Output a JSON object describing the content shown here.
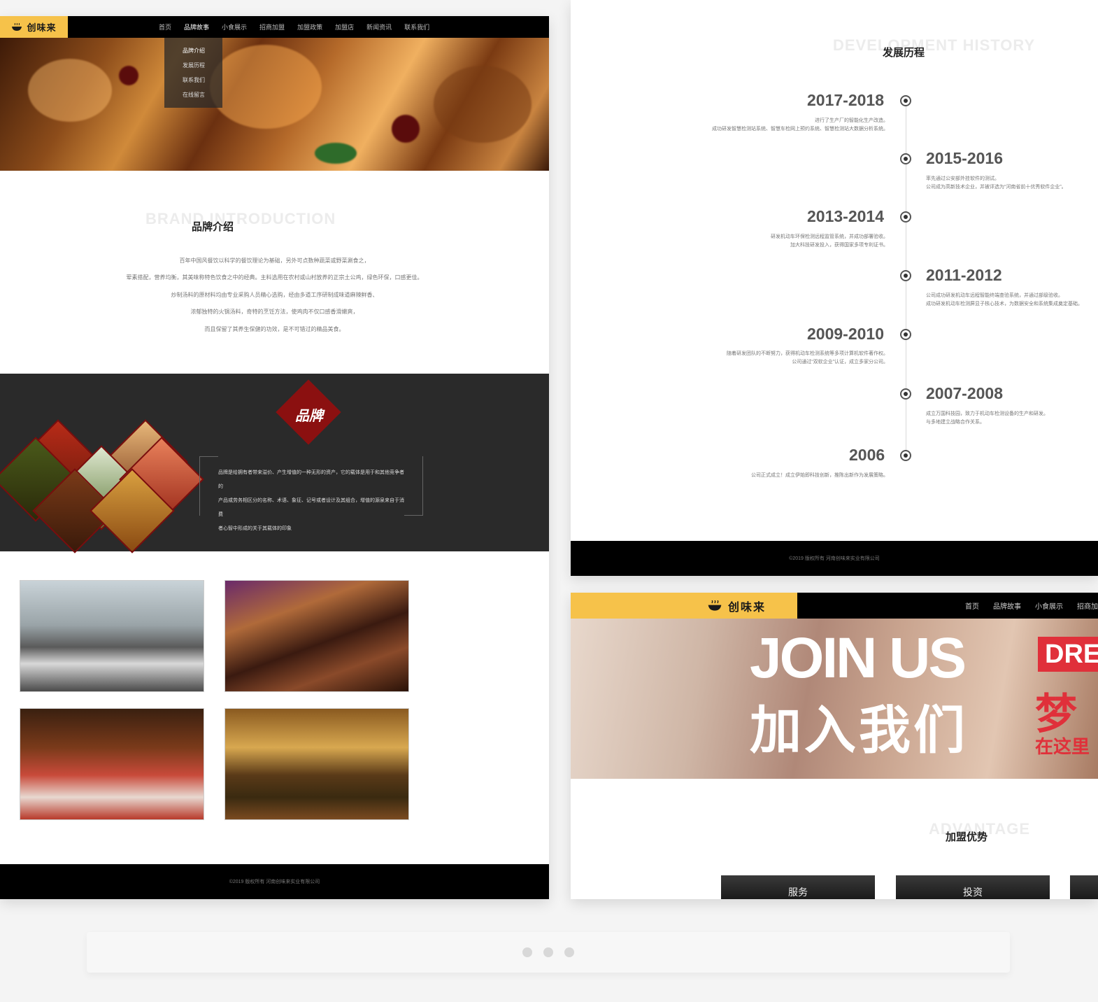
{
  "left_page": {
    "logo_text": "创味来",
    "nav": [
      "首页",
      "品牌故事",
      "小食展示",
      "招商加盟",
      "加盟政策",
      "加盟店",
      "新闻资讯",
      "联系我们"
    ],
    "dropdown": [
      "品牌介绍",
      "发展历程",
      "联系我们",
      "在线留言"
    ],
    "intro": {
      "watermark": "BRAND INTRODUCTION",
      "title": "品牌介绍",
      "lines": [
        "百年中国风餐饮以科学的餐饮理论为基础，另外可点数种蔬菜或野菜涮食之，",
        "荤素搭配，营养均衡，其美味称特色饮食之中的经典。主料选用在农村或山村放养的正宗土公鸡，绿色环保，口感更佳。",
        "炒制汤料的原材料均由专业采购人员精心选购，经由多道工序研制成味道麻辣鲜香、",
        "浓郁独特的火锅汤料，奇特的烹饪方法，使鸡肉不仅口感香滑嫩爽，",
        "而且保留了其养生保健的功效，是不可错过的精品美食。"
      ]
    },
    "brand": {
      "badge": "品牌",
      "text": [
        "品牌是给拥有者带来溢价、产生增值的一种无形的资产，它的载体是用于和其他竞争者的",
        "产品或劳务相区分的名称、术语、象征、记号或者设计及其组合，增值的源泉来自于消费",
        "者心智中形成的关于其载体的印象"
      ]
    },
    "footer": "©2019 版权所有 河南创味来实业有限公司"
  },
  "right_top": {
    "watermark": "DEVELOPMENT HISTORY",
    "title": "发展历程",
    "timeline": [
      {
        "year": "2017-2018",
        "lines": [
          "进行了生产厂的智能化生产改造。",
          "成功研发智慧检测站系统、智慧车检网上预约系统、智慧检测站大数据分析系统。"
        ]
      },
      {
        "year": "2015-2016",
        "lines": [
          "率先通过公安部外挂软件的测试。",
          "公司成为高新技术企业，并被评选为“河南省前十优秀软件企业”。"
        ]
      },
      {
        "year": "2013-2014",
        "lines": [
          "研发机动车环保检测远程监管系统，并成功部署验收。",
          "加大科技研发投入，获得国家多项专利证书。"
        ]
      },
      {
        "year": "2011-2012",
        "lines": [
          "公司成功研发机动车远程智能终端查验系统，并通过部级验收。",
          "成功研发机动车检测屏显子核心技术，为数据安全和系统集成奠定基础。"
        ]
      },
      {
        "year": "2009-2010",
        "lines": [
          "随着研发团队的不断努力，获得机动车检测系统等多项计算机软件著作权。",
          "公司通过“双软企业”认证，成立多家分公司。"
        ]
      },
      {
        "year": "2007-2008",
        "lines": [
          "成立万国科技园，致力于机动车检测设备的生产和研发。",
          "与多地建立战略合作关系。"
        ]
      },
      {
        "year": "2006",
        "lines": [
          "公司正式成立！成立伊始即科技创新，推陈出新作为发展策略。"
        ]
      }
    ],
    "footer": "©2019 版权所有 河南创味来实业有限公司"
  },
  "right_bottom": {
    "logo_text": "创味来",
    "nav": [
      "首页",
      "品牌故事",
      "小食展示",
      "招商加"
    ],
    "banner_en": "JOIN US",
    "banner_cn": "加入我们",
    "banner_tag": "DRE",
    "banner_red1": "梦",
    "banner_red2": "在这里",
    "watermark": "ADVANTAGE",
    "title": "加盟优势",
    "cards": [
      "服务",
      "投资"
    ]
  },
  "colors": {
    "accent": "#f6c24a",
    "brand_red": "#8b1010",
    "dark_band": "#2a2a2a"
  }
}
